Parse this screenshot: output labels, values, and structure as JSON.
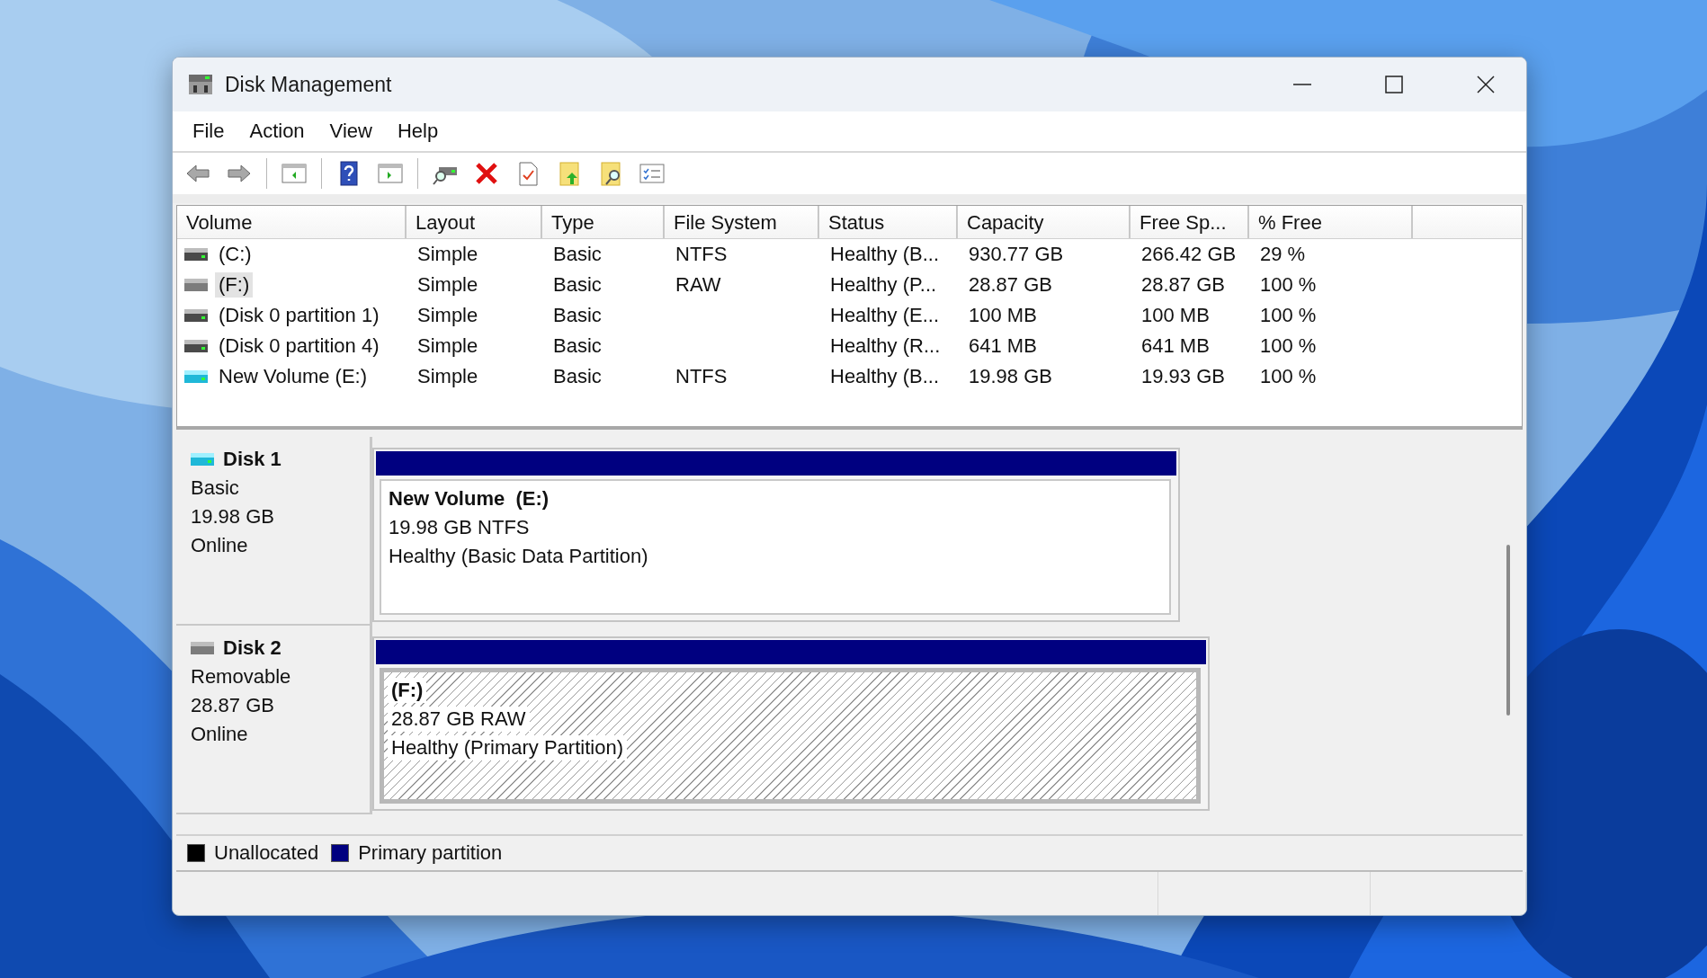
{
  "window": {
    "title": "Disk Management"
  },
  "menu": [
    "File",
    "Action",
    "View",
    "Help"
  ],
  "table": {
    "columns": [
      "Volume",
      "Layout",
      "Type",
      "File System",
      "Status",
      "Capacity",
      "Free Sp...",
      "% Free"
    ],
    "rows": [
      {
        "kind": "fixed",
        "selected": false,
        "cells": [
          "(C:)",
          "Simple",
          "Basic",
          "NTFS",
          "Healthy (B...",
          "930.77 GB",
          "266.42 GB",
          "29 %"
        ]
      },
      {
        "kind": "removable",
        "selected": true,
        "cells": [
          "(F:)",
          "Simple",
          "Basic",
          "RAW",
          "Healthy (P...",
          "28.87 GB",
          "28.87 GB",
          "100 %"
        ]
      },
      {
        "kind": "fixed",
        "selected": false,
        "cells": [
          "(Disk 0 partition 1)",
          "Simple",
          "Basic",
          "",
          "Healthy (E...",
          "100 MB",
          "100 MB",
          "100 %"
        ]
      },
      {
        "kind": "fixed",
        "selected": false,
        "cells": [
          "(Disk 0 partition 4)",
          "Simple",
          "Basic",
          "",
          "Healthy (R...",
          "641 MB",
          "641 MB",
          "100 %"
        ]
      },
      {
        "kind": "virtual",
        "selected": false,
        "cells": [
          "New Volume (E:)",
          "Simple",
          "Basic",
          "NTFS",
          "Healthy (B...",
          "19.98 GB",
          "19.93 GB",
          "100 %"
        ]
      }
    ]
  },
  "disks": [
    {
      "name": "Disk 1",
      "kind": "virtual",
      "type": "Basic",
      "size": "19.98 GB",
      "status": "Online",
      "partitions": [
        {
          "name": "New Volume  (E:)",
          "detail": "19.98 GB NTFS",
          "health": "Healthy (Basic Data Partition)",
          "selected": false
        }
      ]
    },
    {
      "name": "Disk 2",
      "kind": "removable",
      "type": "Removable",
      "size": "28.87 GB",
      "status": "Online",
      "partitions": [
        {
          "name": "(F:)",
          "detail": "28.87 GB RAW",
          "health": "Healthy (Primary Partition)",
          "selected": true
        }
      ]
    }
  ],
  "legend": [
    {
      "label": "Unallocated",
      "color": "#000000"
    },
    {
      "label": "Primary partition",
      "color": "#000080"
    }
  ]
}
